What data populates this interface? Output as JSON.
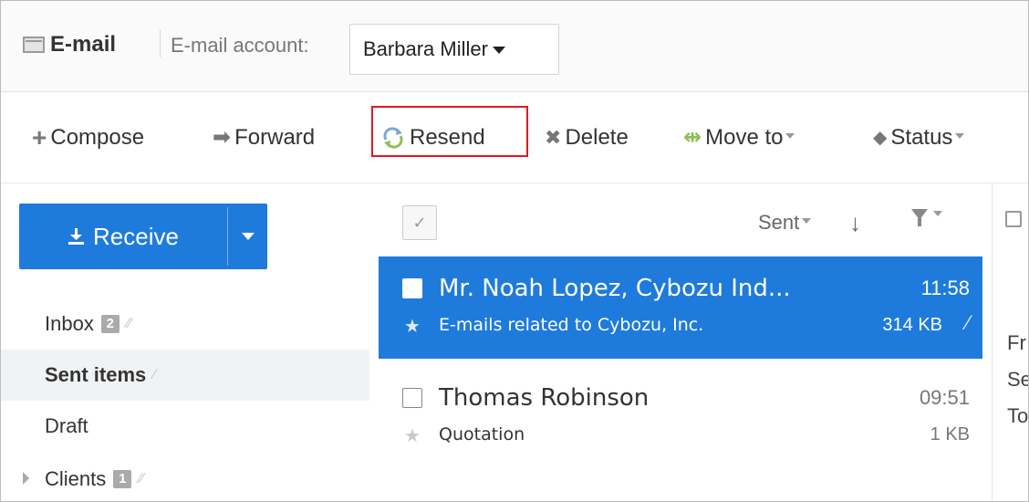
{
  "header": {
    "app_title": "E-mail",
    "account_label": "E-mail account:",
    "account_value": "Barbara Miller"
  },
  "toolbar": {
    "compose": "Compose",
    "forward": "Forward",
    "resend": "Resend",
    "delete": "Delete",
    "move_to": "Move to",
    "status": "Status"
  },
  "sidebar": {
    "receive": "Receive",
    "folders": [
      {
        "label": "Inbox",
        "badge": "2"
      },
      {
        "label": "Sent items"
      },
      {
        "label": "Draft"
      },
      {
        "label": "Clients",
        "badge": "1"
      }
    ]
  },
  "list": {
    "sort_label": "Sent",
    "mails": [
      {
        "sender": "Mr. Noah Lopez, Cybozu Ind...",
        "time": "11:58",
        "subject": "E-mails related to Cybozu, Inc.",
        "size": "314 KB"
      },
      {
        "sender": "Thomas Robinson",
        "time": "09:51",
        "subject": "Quotation",
        "size": "1 KB"
      }
    ]
  },
  "preview": {
    "lines": [
      "Fr",
      "Se",
      "To"
    ]
  },
  "colors": {
    "accent": "#1e7bdc",
    "highlight_border": "#e0191e",
    "active_folder_bg": "#f0f2f4"
  },
  "icons": {
    "compose": "plus-icon",
    "forward": "arrow-right-icon",
    "resend": "recycle-icon",
    "delete": "x-icon",
    "move_to": "double-arrow-icon",
    "status": "tag-icon",
    "receive": "download-icon"
  }
}
